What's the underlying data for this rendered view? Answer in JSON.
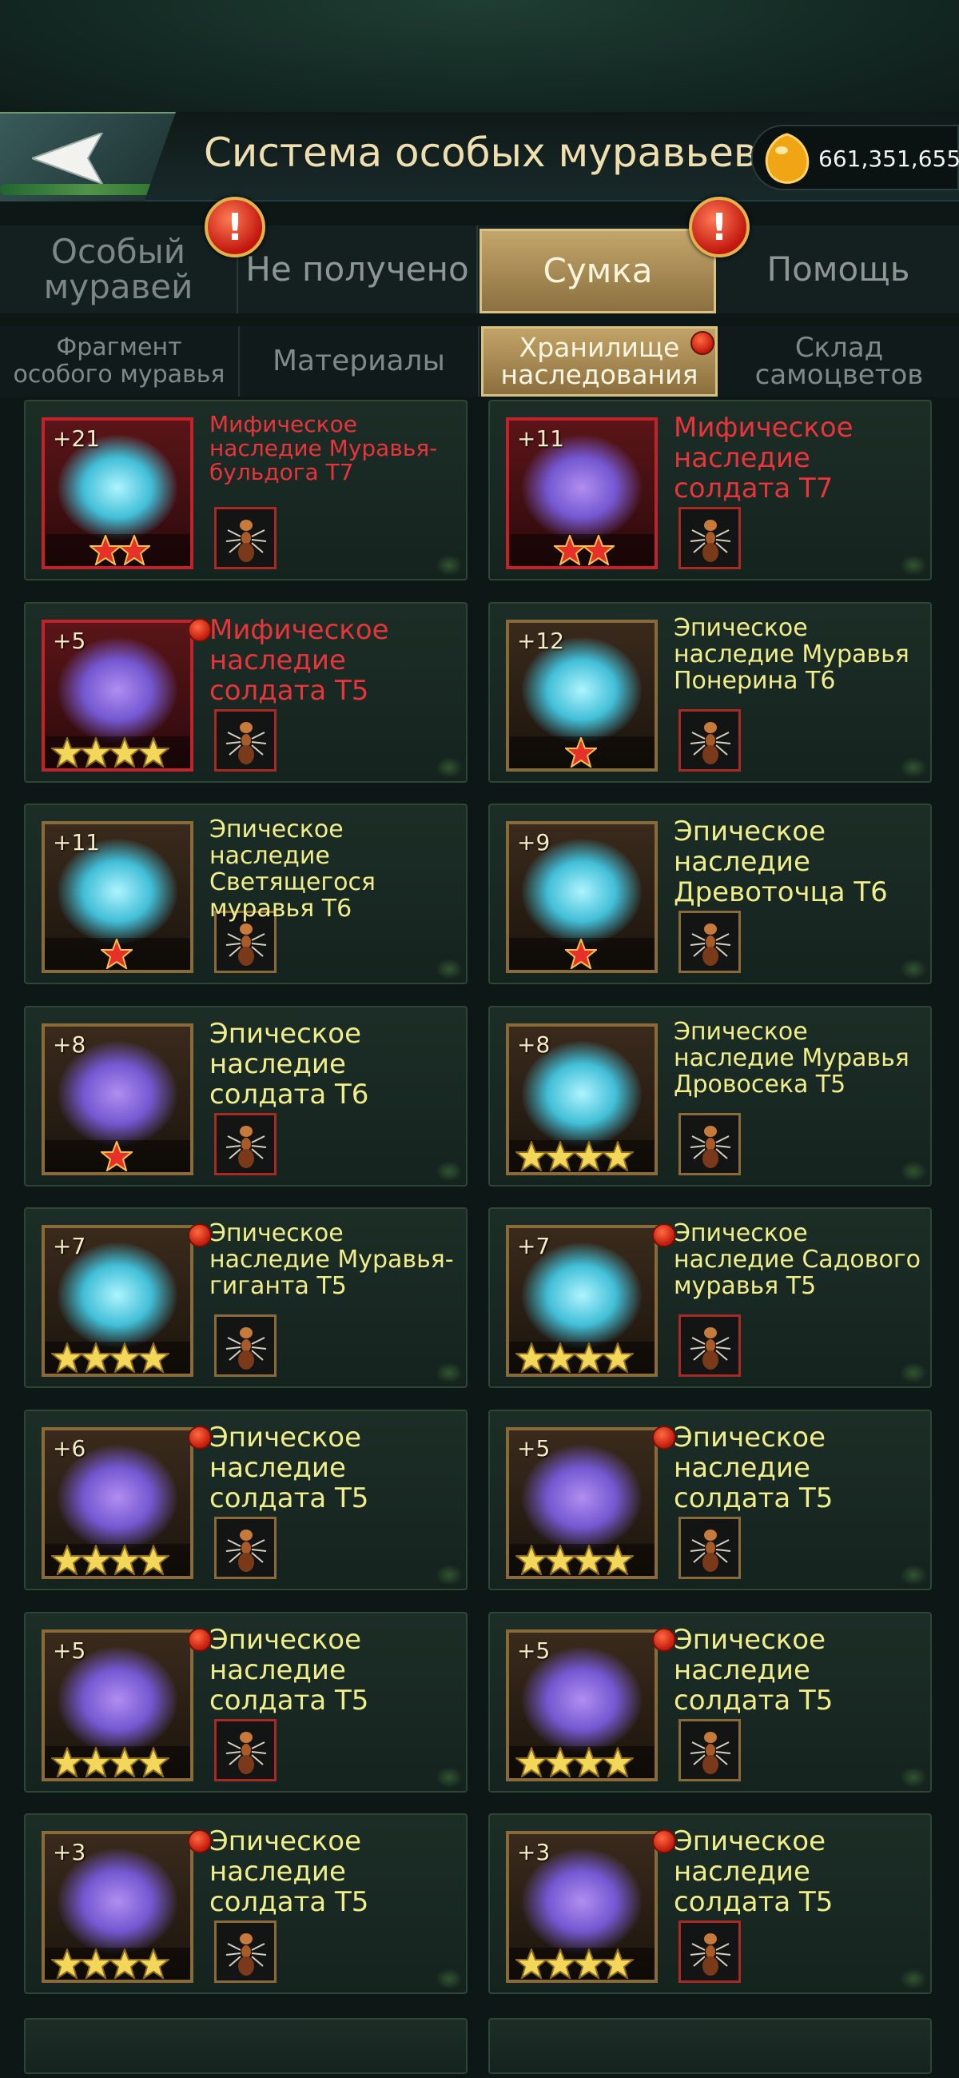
{
  "header": {
    "title": "Система особых муравьев",
    "currency_value": "661,351,655"
  },
  "tabs": [
    {
      "label": "Особый муравей",
      "active": false,
      "alert": true
    },
    {
      "label": "Не получено",
      "active": false,
      "alert": false
    },
    {
      "label": "Сумка",
      "active": true,
      "alert": true
    },
    {
      "label": "Помощь",
      "active": false,
      "alert": false
    }
  ],
  "subtabs": [
    {
      "label": "Фрагмент особого муравья",
      "active": false
    },
    {
      "label": "Материалы",
      "active": false
    },
    {
      "label": "Хранилище наследования",
      "active": true,
      "dot": true
    },
    {
      "label": "Склад самоцветов",
      "active": false
    }
  ],
  "cards": [
    {
      "level": "+21",
      "name": "Мифическое наследие Муравья-бульдога T7",
      "rarity": "mythic",
      "stars": 2,
      "star_color": "red",
      "glow": "cyan",
      "dot": false,
      "thumb": "bulldog-ant-icon"
    },
    {
      "level": "+11",
      "name": "Мифическое наследие солдата T7",
      "rarity": "mythic",
      "stars": 2,
      "star_color": "red",
      "glow": "purple",
      "dot": false,
      "thumb": "soldier-ant-icon"
    },
    {
      "level": "+5",
      "name": "Мифическое наследие солдата T5",
      "rarity": "mythic",
      "stars": 4,
      "star_color": "gold",
      "glow": "purple",
      "dot": true,
      "thumb": "white-ant-icon"
    },
    {
      "level": "+12",
      "name": "Эпическое наследие Муравья Понерина T6",
      "rarity": "epic",
      "stars": 1,
      "star_color": "red",
      "glow": "cyan",
      "dot": false,
      "thumb": "ponerine-ant-icon"
    },
    {
      "level": "+11",
      "name": "Эпическое наследие Светящегося муравья T6",
      "rarity": "epic",
      "stars": 1,
      "star_color": "red",
      "glow": "cyan",
      "dot": false,
      "thumb": "glowing-ant-icon"
    },
    {
      "level": "+9",
      "name": "Эпическое наследие Древоточца T6",
      "rarity": "epic",
      "stars": 1,
      "star_color": "red",
      "glow": "cyan",
      "dot": false,
      "thumb": "woodborer-ant-icon"
    },
    {
      "level": "+8",
      "name": "Эпическое наследие солдата T6",
      "rarity": "epic",
      "stars": 1,
      "star_color": "red",
      "glow": "purple",
      "dot": false,
      "thumb": "orange-ant-icon"
    },
    {
      "level": "+8",
      "name": "Эпическое наследие Муравья Дровосека T5",
      "rarity": "epic",
      "stars": 4,
      "star_color": "gold",
      "glow": "cyan",
      "dot": false,
      "thumb": "woodcutter-ant-icon"
    },
    {
      "level": "+7",
      "name": "Эпическое наследие Муравья-гиганта T5",
      "rarity": "epic",
      "stars": 4,
      "star_color": "gold",
      "glow": "cyan",
      "dot": true,
      "thumb": "giant-ant-icon"
    },
    {
      "level": "+7",
      "name": "Эпическое наследие Садового муравья T5",
      "rarity": "epic",
      "stars": 4,
      "star_color": "gold",
      "glow": "cyan",
      "dot": true,
      "thumb": "garden-ant-icon"
    },
    {
      "level": "+6",
      "name": "Эпическое наследие солдата T5",
      "rarity": "epic",
      "stars": 4,
      "star_color": "gold",
      "glow": "purple",
      "dot": true,
      "thumb": "soldier-ant-icon"
    },
    {
      "level": "+5",
      "name": "Эпическое наследие солдата T5",
      "rarity": "epic",
      "stars": 4,
      "star_color": "gold",
      "glow": "purple",
      "dot": true,
      "thumb": "soldier-ant-icon"
    },
    {
      "level": "+5",
      "name": "Эпическое наследие солдата T5",
      "rarity": "epic",
      "stars": 4,
      "star_color": "gold",
      "glow": "purple",
      "dot": true,
      "thumb": "red-ant-icon"
    },
    {
      "level": "+5",
      "name": "Эпическое наследие солдата T5",
      "rarity": "epic",
      "stars": 4,
      "star_color": "gold",
      "glow": "purple",
      "dot": true,
      "thumb": "orange-ant-icon"
    },
    {
      "level": "+3",
      "name": "Эпическое наследие солдата T5",
      "rarity": "epic",
      "stars": 4,
      "star_color": "gold",
      "glow": "purple",
      "dot": true,
      "thumb": "soldier-ant-icon"
    },
    {
      "level": "+3",
      "name": "Эпическое наследие солдата T5",
      "rarity": "epic",
      "stars": 4,
      "star_color": "gold",
      "glow": "purple",
      "dot": true,
      "thumb": "brown-ant-icon"
    }
  ]
}
